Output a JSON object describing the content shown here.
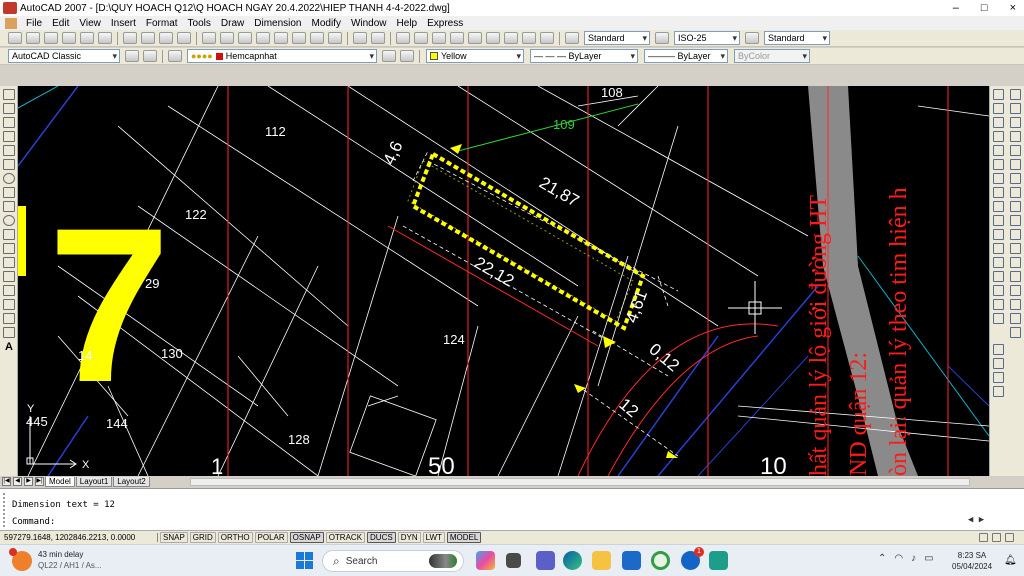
{
  "window": {
    "title": "AutoCAD 2007 - [D:\\QUY HOACH Q12\\Q HOACH NGAY 20.4.2022\\HIEP THANH 4-4-2022.dwg]",
    "controls": [
      "–",
      "□",
      "×"
    ]
  },
  "menu": [
    "File",
    "Edit",
    "View",
    "Insert",
    "Format",
    "Tools",
    "Draw",
    "Dimension",
    "Modify",
    "Window",
    "Help",
    "Express"
  ],
  "toolbar1": {
    "text_style": "Standard",
    "dim_style": "ISO-25",
    "table_style": "Standard"
  },
  "toolbar2": {
    "workspace": "AutoCAD Classic",
    "layer": "Hemcapnhat",
    "color": "Yellow",
    "linetype": "ByLayer",
    "lineweight": "ByLayer",
    "plotstyle": "ByColor"
  },
  "drawing": {
    "lot_numbers": [
      "108",
      "109",
      "112",
      "122",
      "29",
      "130",
      "14",
      "124",
      "144",
      "128",
      "445",
      "1",
      "50",
      "10"
    ],
    "dimensions": [
      "4,6",
      "21,87",
      "22,12",
      "4,61",
      "0,12",
      "12"
    ],
    "big_label": "7",
    "red_text": [
      "hất quản lý lộ giới đường HT",
      "ND quận 12:",
      "òn lại: quản lý theo tim hiện h"
    ],
    "ucs": {
      "x": "X",
      "y": "Y"
    },
    "colors": {
      "background": "#000000",
      "highlight": "#ffff00",
      "annotation": "#ff1a1a",
      "road": "#8a8a8a"
    }
  },
  "layout_tabs": [
    "Model",
    "Layout1",
    "Layout2"
  ],
  "command": {
    "history": "Dimension text = 12",
    "prompt": "Command:"
  },
  "status": {
    "coordinates": "597279.1648, 1202846.2213, 0.0000",
    "toggles": [
      "SNAP",
      "GRID",
      "ORTHO",
      "POLAR",
      "OSNAP",
      "OTRACK",
      "DUCS",
      "DYN",
      "LWT",
      "MODEL"
    ],
    "active_toggles": [
      "OSNAP",
      "DUCS",
      "MODEL"
    ]
  },
  "taskbar": {
    "weather_title": "43 min delay",
    "weather_sub": "QL22 / AH1 / As...",
    "weather_badge": "1",
    "search_placeholder": "Search",
    "teams_badge": "1",
    "time": "8:23 SA",
    "date": "05/04/2024"
  }
}
